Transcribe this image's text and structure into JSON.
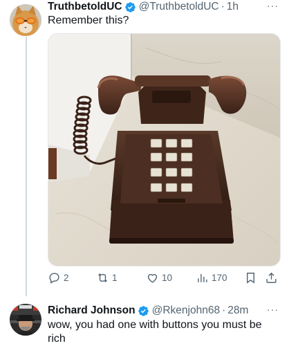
{
  "post": {
    "display_name": "TruthbetoldUC",
    "handle": "@TruthbetoldUC",
    "separator": "·",
    "time": "1h",
    "more": "···",
    "text": "Remember this?",
    "image_icon": "push-button-telephone-photo",
    "actions": {
      "replies": "2",
      "retweets": "1",
      "likes": "10",
      "views": "170"
    }
  },
  "reply": {
    "display_name": "Richard Johnson",
    "handle": "@Rkenjohn68",
    "separator": "·",
    "time": "28m",
    "more": "···",
    "text": "wow, you had one with buttons you must be rich"
  },
  "colors": {
    "verified": "#1d9bf0",
    "muted": "#536471",
    "divider": "#cfd9de"
  },
  "icons": [
    "verified-badge-icon",
    "reply-icon",
    "retweet-icon",
    "like-icon",
    "views-icon",
    "bookmark-icon",
    "share-icon",
    "more-icon"
  ]
}
